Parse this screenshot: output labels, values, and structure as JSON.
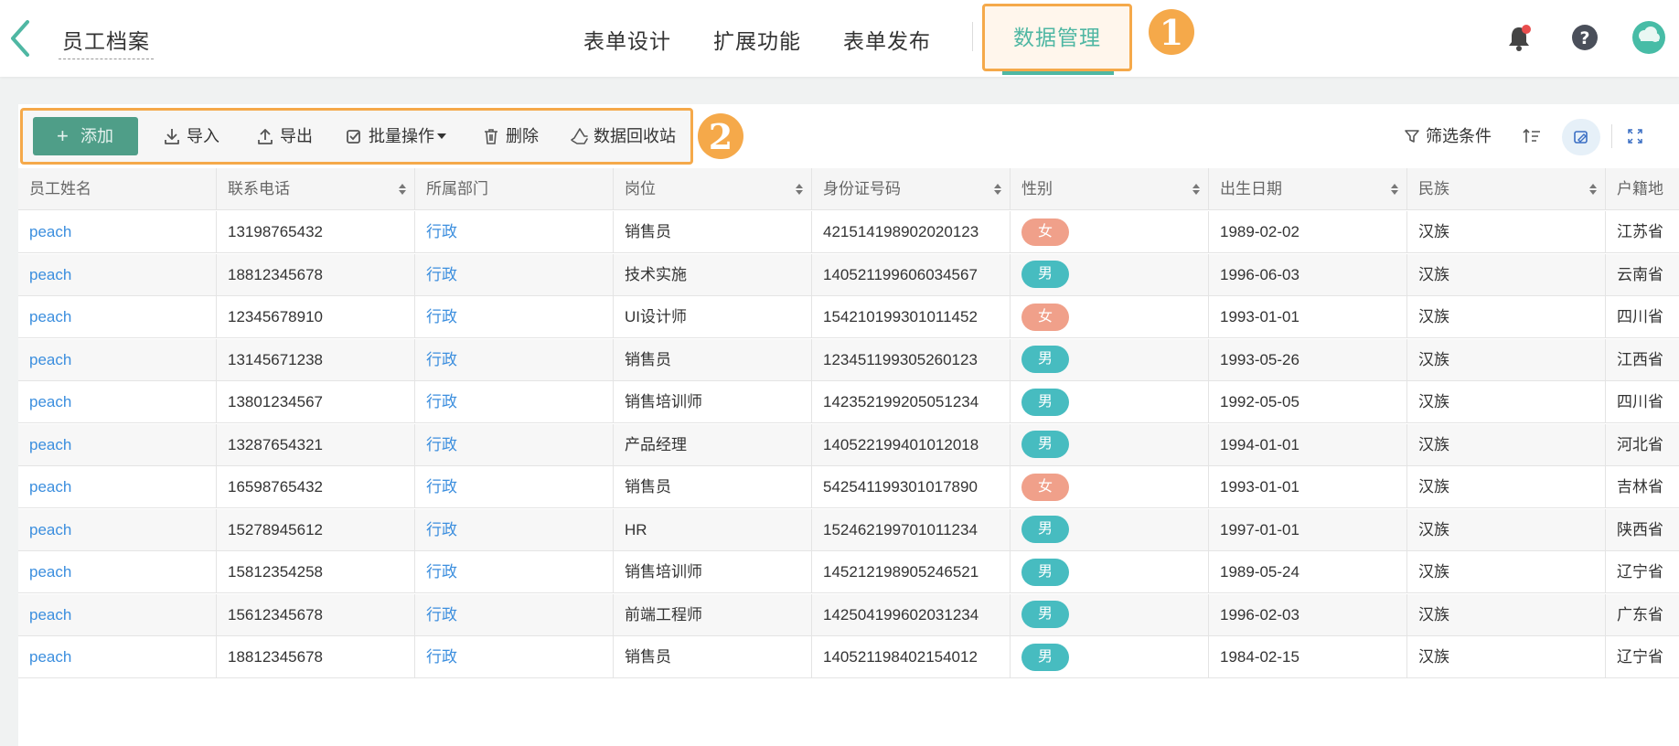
{
  "header": {
    "title": "员工档案",
    "tabs": [
      "表单设计",
      "扩展功能",
      "表单发布"
    ],
    "active_tab": "数据管理",
    "callout_1": "1",
    "callout_2": "2"
  },
  "toolbar": {
    "add": "添加",
    "import": "导入",
    "export": "导出",
    "batch": "批量操作",
    "delete": "删除",
    "recycle": "数据回收站",
    "filter": "筛选条件"
  },
  "table": {
    "columns": [
      "员工姓名",
      "联系电话",
      "所属部门",
      "岗位",
      "身份证号码",
      "性别",
      "出生日期",
      "民族",
      "户籍地"
    ],
    "rows": [
      [
        "peach",
        "13198765432",
        "行政",
        "销售员",
        "421514198902020123",
        "女",
        "1989-02-02",
        "汉族",
        "江苏省"
      ],
      [
        "peach",
        "18812345678",
        "行政",
        "技术实施",
        "140521199606034567",
        "男",
        "1996-06-03",
        "汉族",
        "云南省"
      ],
      [
        "peach",
        "12345678910",
        "行政",
        "UI设计师",
        "154210199301011452",
        "女",
        "1993-01-01",
        "汉族",
        "四川省"
      ],
      [
        "peach",
        "13145671238",
        "行政",
        "销售员",
        "123451199305260123",
        "男",
        "1993-05-26",
        "汉族",
        "江西省"
      ],
      [
        "peach",
        "13801234567",
        "行政",
        "销售培训师",
        "142352199205051234",
        "男",
        "1992-05-05",
        "汉族",
        "四川省"
      ],
      [
        "peach",
        "13287654321",
        "行政",
        "产品经理",
        "140522199401012018",
        "男",
        "1994-01-01",
        "汉族",
        "河北省"
      ],
      [
        "peach",
        "16598765432",
        "行政",
        "销售员",
        "542541199301017890",
        "女",
        "1993-01-01",
        "汉族",
        "吉林省"
      ],
      [
        "peach",
        "15278945612",
        "行政",
        "HR",
        "152462199701011234",
        "男",
        "1997-01-01",
        "汉族",
        "陕西省"
      ],
      [
        "peach",
        "15812354258",
        "行政",
        "销售培训师",
        "145212198905246521",
        "男",
        "1989-05-24",
        "汉族",
        "辽宁省"
      ],
      [
        "peach",
        "15612345678",
        "行政",
        "前端工程师",
        "142504199602031234",
        "男",
        "1996-02-03",
        "汉族",
        "广东省"
      ],
      [
        "peach",
        "18812345678",
        "行政",
        "销售员",
        "140521198402154012",
        "男",
        "1984-02-15",
        "汉族",
        "辽宁省"
      ]
    ]
  },
  "colors": {
    "accent": "#4fb7a3",
    "highlight": "#f5a94a",
    "link": "#3b8ede",
    "female": "#f0a08a",
    "male": "#47bcc0"
  }
}
